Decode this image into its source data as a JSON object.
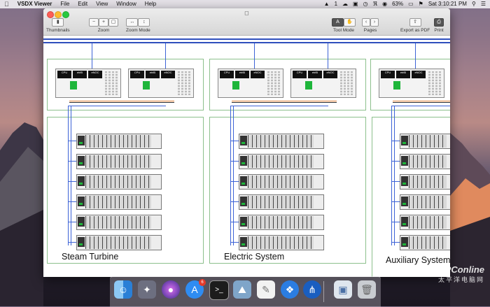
{
  "menubar": {
    "app_name": "VSDX Viewer",
    "menus": [
      "File",
      "Edit",
      "View",
      "Window",
      "Help"
    ],
    "status": {
      "adobe_count": "1",
      "battery": "63%",
      "datetime": "Sat 3:10:21 PM"
    }
  },
  "window": {
    "title": "",
    "toolbar": {
      "thumbnails": "Thumbnails",
      "zoom": "Zoom",
      "zoom_mode": "Zoom Mode",
      "tool_mode": "Tool Mode",
      "pages": "Pages",
      "export_pdf": "Export as PDF",
      "print": "Print"
    }
  },
  "diagram": {
    "sections": [
      {
        "caption": "Steam Turbine"
      },
      {
        "caption": "Electric System"
      },
      {
        "caption": "Auxiliary System"
      }
    ],
    "controller_labels": {
      "cpu": "CPU",
      "module1": "etrlB",
      "module2": "eNOC"
    }
  },
  "dock": {
    "apps": [
      "finder",
      "launchpad",
      "siri",
      "app-store",
      "terminal",
      "preview",
      "textedit",
      "safari",
      "vsdx-viewer",
      "image-viewer",
      "trash"
    ],
    "app_store_badge": "6"
  },
  "watermark": {
    "line1": "PConline",
    "line2": "太平洋电脑网"
  }
}
